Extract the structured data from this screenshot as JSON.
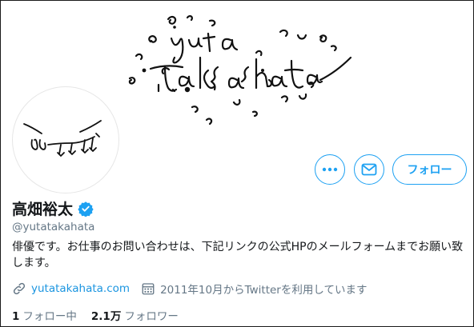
{
  "profile": {
    "name": "高畑裕太",
    "handle": "@yutatakahata",
    "bio": "俳優です。お仕事のお問い合わせは、下記リンクの公式HPのメールフォームまでお願い致します。",
    "website": "yutatakahata.com",
    "joined": "2011年10月からTwitterを利用しています",
    "banner_text": "yuta takahata"
  },
  "actions": {
    "more_icon": "more-dots-icon",
    "message_icon": "envelope-icon",
    "follow_label": "フォロー"
  },
  "stats": {
    "following_count": "1",
    "following_label": "フォロー中",
    "followers_count": "2.1万",
    "followers_label": "フォロワー"
  },
  "colors": {
    "accent": "#1da1f2",
    "link": "#1b95e0",
    "text": "#14171a",
    "secondary": "#657786",
    "verified": "#1da1f2"
  }
}
